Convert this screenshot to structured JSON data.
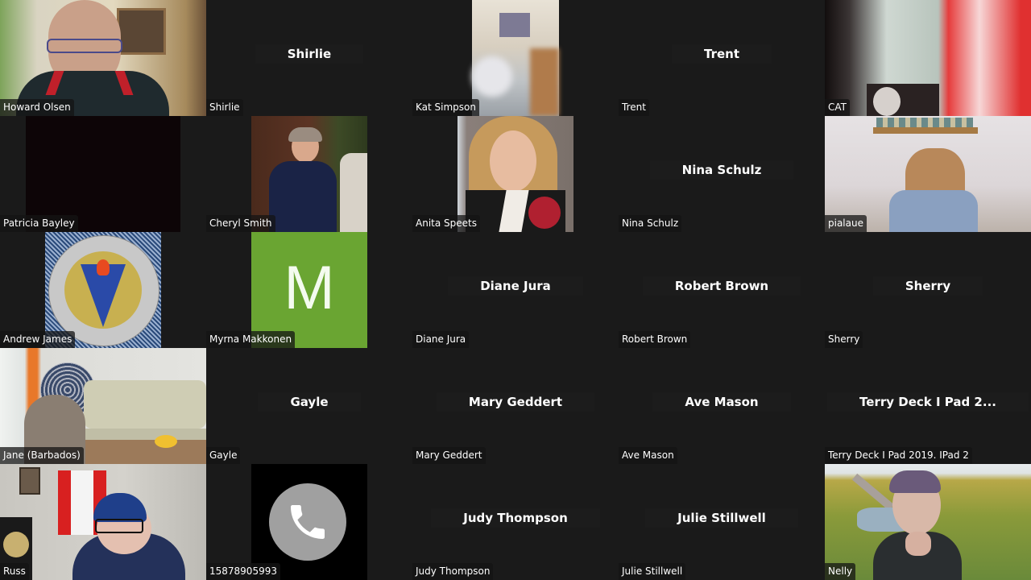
{
  "app": "Zoom gallery view",
  "participants": [
    {
      "name": "Howard Olsen",
      "type": "video",
      "scene": "man with glasses in home office"
    },
    {
      "name": "Shirlie",
      "type": "no-video",
      "center_name": "Shirlie"
    },
    {
      "name": "Kat Simpson",
      "type": "video",
      "scene": "blurry room"
    },
    {
      "name": "Trent",
      "type": "no-video",
      "center_name": "Trent"
    },
    {
      "name": "CAT",
      "type": "video",
      "scene": "dark room with red curtain"
    },
    {
      "name": "Patricia Bayley",
      "type": "video",
      "scene": "black video"
    },
    {
      "name": "Cheryl Smith",
      "type": "photo",
      "scene": "woman smiling"
    },
    {
      "name": "Anita Speets",
      "type": "photo",
      "scene": "graduation photo"
    },
    {
      "name": "Nina Schulz",
      "type": "no-video",
      "center_name": "Nina Schulz"
    },
    {
      "name": "pialaue",
      "type": "video",
      "scene": "woman with shelf"
    },
    {
      "name": "Andrew James",
      "type": "photo",
      "scene": "victory coin"
    },
    {
      "name": "Myrna Makkonen",
      "type": "avatar",
      "avatar_letter": "M",
      "avatar_color": "#6aa532"
    },
    {
      "name": "Diane Jura",
      "type": "no-video",
      "center_name": "Diane Jura"
    },
    {
      "name": "Robert Brown",
      "type": "no-video",
      "center_name": "Robert Brown"
    },
    {
      "name": "Sherry",
      "type": "no-video",
      "center_name": "Sherry"
    },
    {
      "name": "Jane (Barbados)",
      "type": "video",
      "scene": "living room with fan"
    },
    {
      "name": "Gayle",
      "type": "no-video",
      "center_name": "Gayle"
    },
    {
      "name": "Mary Geddert",
      "type": "no-video",
      "center_name": "Mary Geddert"
    },
    {
      "name": "Ave Mason",
      "type": "no-video",
      "center_name": "Ave Mason"
    },
    {
      "name": "Terry Deck I Pad 2019. IPad 2",
      "type": "no-video",
      "center_name": "Terry Deck I Pad 2..."
    },
    {
      "name": "Russ",
      "type": "video",
      "scene": "man in Maple Leafs cap"
    },
    {
      "name": "15878905993",
      "type": "phone",
      "icon": "phone-icon"
    },
    {
      "name": "Judy Thompson",
      "type": "no-video",
      "center_name": "Judy Thompson"
    },
    {
      "name": "Julie Stillwell",
      "type": "no-video",
      "center_name": "Julie Stillwell"
    },
    {
      "name": "Nelly",
      "type": "video",
      "scene": "marsh boardwalk background"
    }
  ]
}
